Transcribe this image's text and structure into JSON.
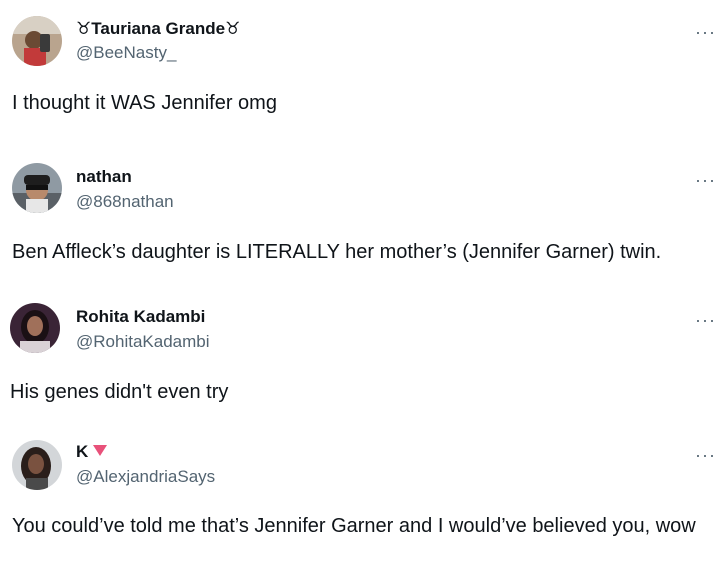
{
  "tweets": [
    {
      "display_name": "♉Tauriana Grande♉",
      "handle": "@BeeNasty_",
      "text": "I thought it WAS Jennifer omg",
      "more_label": "···"
    },
    {
      "display_name": "nathan",
      "handle": "@868nathan",
      "text": "Ben Affleck’s daughter is LITERALLY her mother’s (Jennifer Garner) twin.",
      "more_label": "···"
    },
    {
      "display_name": "Rohita Kadambi",
      "handle": "@RohitaKadambi",
      "text": "His genes didn't even try",
      "more_label": "···"
    },
    {
      "display_name": "K",
      "name_emoji": "pink-triangle-down-icon",
      "handle": "@AlexjandriaSays",
      "text": "You could’ve told me that’s Jennifer Garner and I would’ve believed you, wow",
      "more_label": "···"
    }
  ],
  "colors": {
    "text": "#0f1419",
    "secondary": "#536471",
    "emoji_pink": "#e8517a"
  }
}
